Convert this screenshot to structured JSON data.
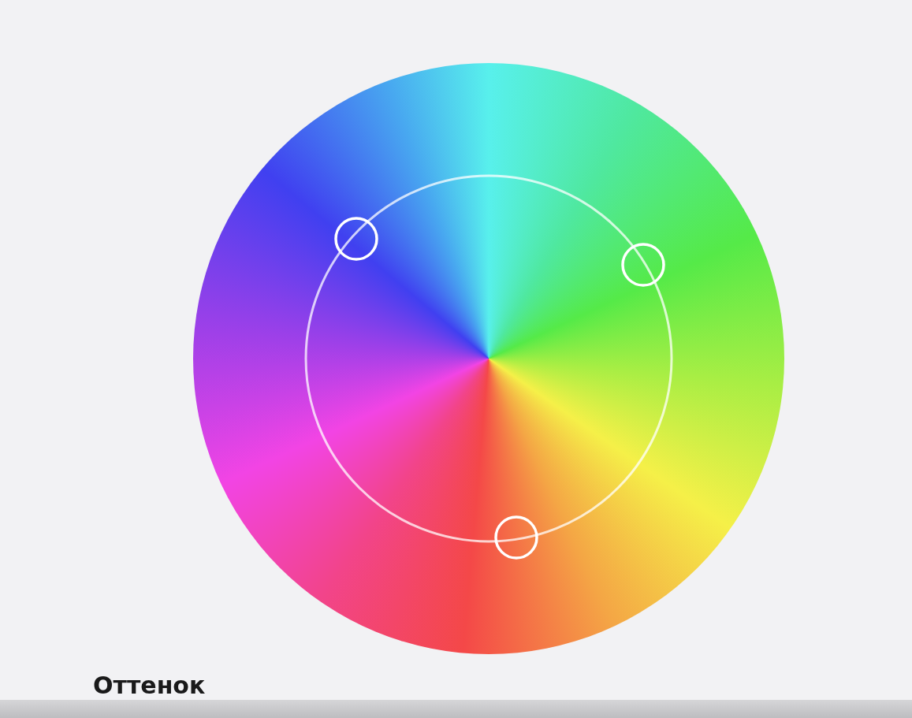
{
  "section_title": "Оттенок"
}
